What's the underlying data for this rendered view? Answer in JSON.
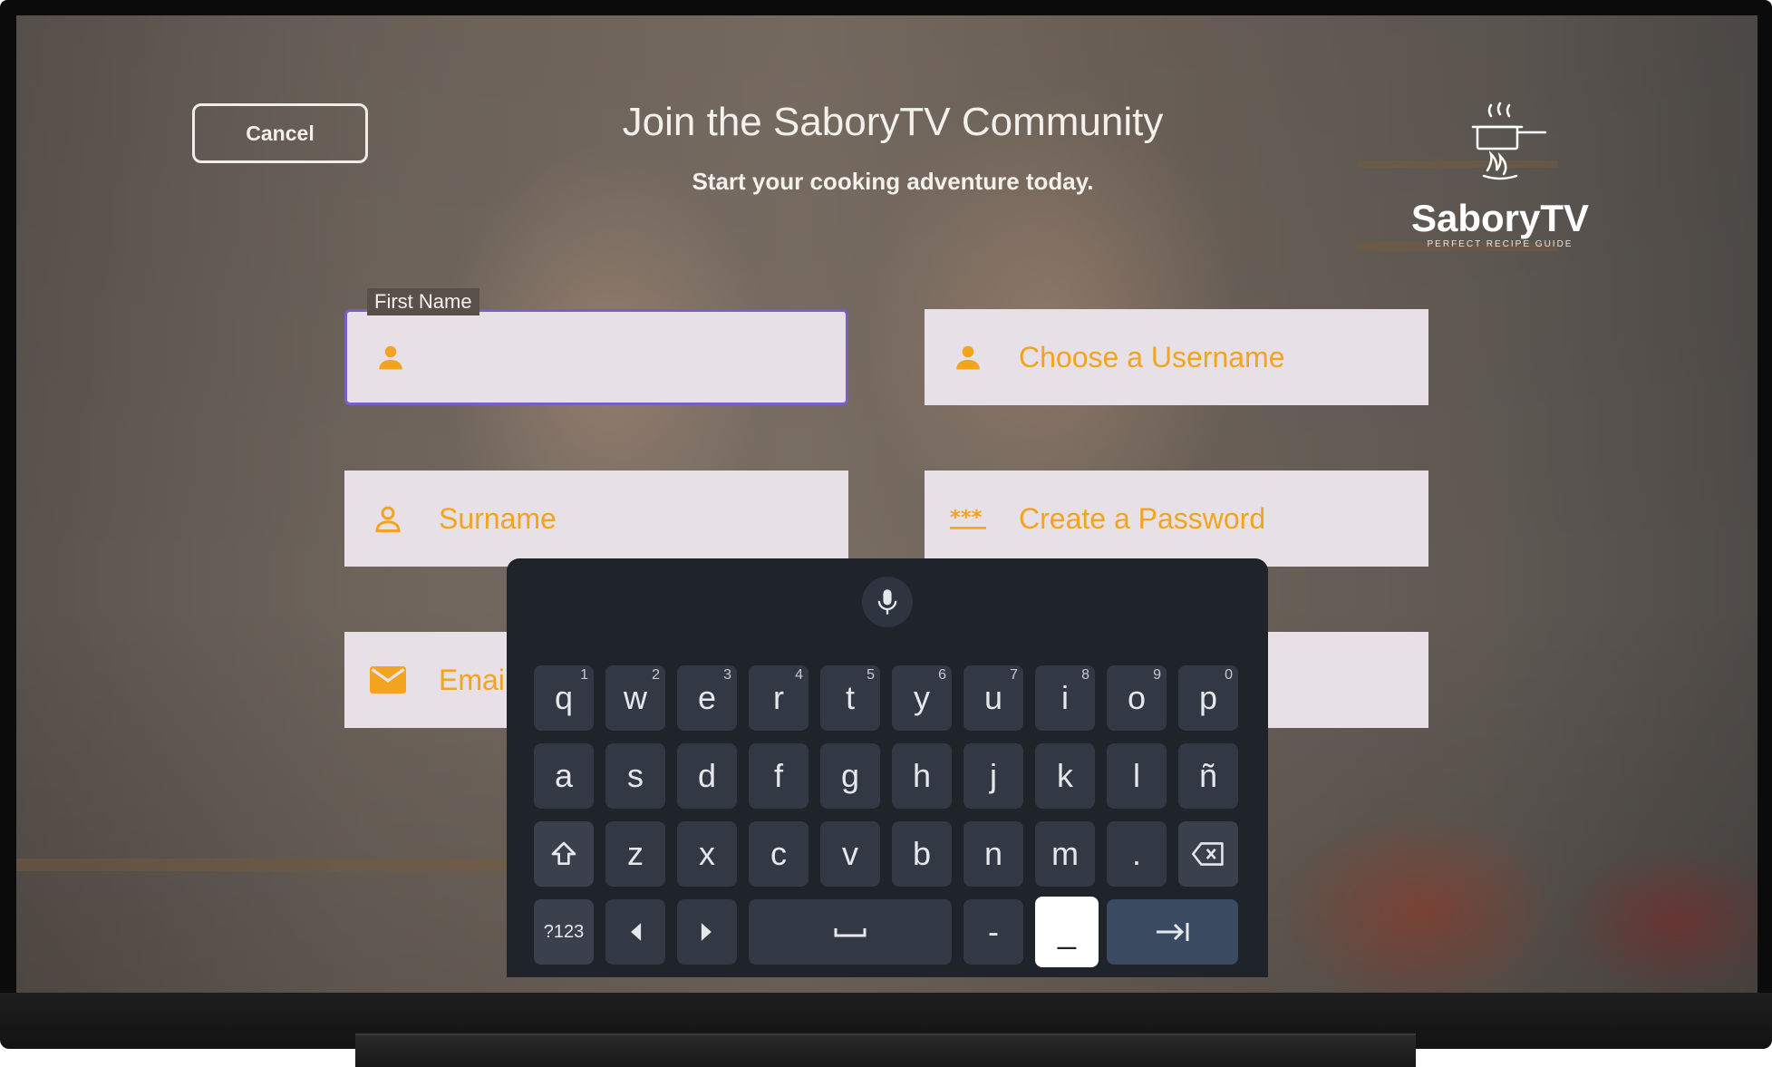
{
  "header": {
    "cancel_label": "Cancel",
    "title": "Join the SaboryTV Community",
    "subtitle": "Start your cooking adventure today."
  },
  "logo": {
    "name": "SaboryTV",
    "tagline": "PERFECT RECIPE GUIDE"
  },
  "form": {
    "first_name": {
      "label": "First Name",
      "value": "",
      "icon": "person-icon"
    },
    "username": {
      "placeholder": "Choose a Username",
      "icon": "person-icon"
    },
    "surname": {
      "placeholder": "Surname",
      "icon": "person-outline-icon"
    },
    "password": {
      "placeholder": "Create a Password",
      "icon": "password-icon"
    },
    "email": {
      "placeholder": "Emai",
      "icon": "mail-icon"
    }
  },
  "keyboard": {
    "row1": [
      {
        "k": "q",
        "n": "1"
      },
      {
        "k": "w",
        "n": "2"
      },
      {
        "k": "e",
        "n": "3"
      },
      {
        "k": "r",
        "n": "4"
      },
      {
        "k": "t",
        "n": "5"
      },
      {
        "k": "y",
        "n": "6"
      },
      {
        "k": "u",
        "n": "7"
      },
      {
        "k": "i",
        "n": "8"
      },
      {
        "k": "o",
        "n": "9"
      },
      {
        "k": "p",
        "n": "0"
      }
    ],
    "row2": [
      "a",
      "s",
      "d",
      "f",
      "g",
      "h",
      "j",
      "k",
      "l",
      "ñ"
    ],
    "row3": [
      "z",
      "x",
      "c",
      "v",
      "b",
      "n",
      "m",
      "."
    ],
    "symbols_label": "?123",
    "dash_label": "-",
    "underscore_label": "_"
  },
  "colors": {
    "placeholder": "#f2a41e",
    "focus_border": "#7a5ec8",
    "keyboard_bg": "#1f232a",
    "key_bg": "#323844"
  }
}
